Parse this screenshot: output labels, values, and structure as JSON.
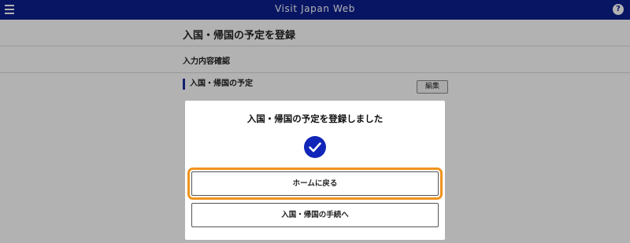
{
  "topbar": {
    "title": "Visit Japan Web",
    "menu_icon": "menu-icon",
    "help_icon": "help-icon",
    "help_glyph": "?",
    "background_color": "#0b1f8f"
  },
  "page": {
    "title": "入国・帰国の予定を登録",
    "section_title": "入力内容確認",
    "sub_heading": "入国・帰国の予定",
    "edit_label": "編集"
  },
  "modal": {
    "title": "入国・帰国の予定を登録しました",
    "success_icon": "check-circle-icon",
    "accent_color": "#1126b8",
    "home_button_label": "ホームに戻る",
    "procedure_button_label": "入国・帰国の手続へ",
    "focus_color": "#f0931e"
  }
}
